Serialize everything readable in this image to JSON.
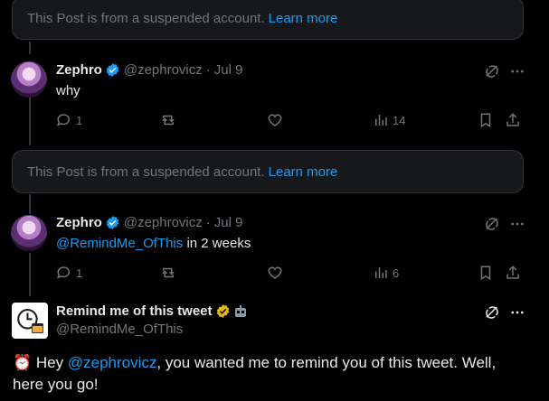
{
  "suspended_notice": {
    "text": "This Post is from a suspended account.",
    "link": "Learn more"
  },
  "posts": [
    {
      "name": "Zephro",
      "handle": "@zephrovicz",
      "sep": "·",
      "date": "Jul 9",
      "text": "why",
      "replies": "1",
      "views": "14"
    },
    {
      "name": "Zephro",
      "handle": "@zephrovicz",
      "sep": "·",
      "date": "Jul 9",
      "mention": "@RemindMe_OfThis",
      "text_after": " in 2 weeks",
      "replies": "1",
      "views": "6"
    }
  ],
  "bot_post": {
    "name": "Remind me of this tweet",
    "handle": "@RemindMe_OfThis",
    "text_prefix": " Hey ",
    "mention": "@zephrovicz",
    "text_rest": ", you wanted me to remind you of this tweet. Well, here you go!"
  },
  "colors": {
    "accent": "#1d9bf0",
    "muted": "#71767b",
    "verified_blue": "#1d9bf0",
    "verified_gold": "#e2b719"
  },
  "icons": [
    "reply-icon",
    "repost-icon",
    "like-icon",
    "views-icon",
    "bookmark-icon",
    "share-icon",
    "grok-icon",
    "more-icon",
    "alarm-clock-icon",
    "verified-icon"
  ]
}
